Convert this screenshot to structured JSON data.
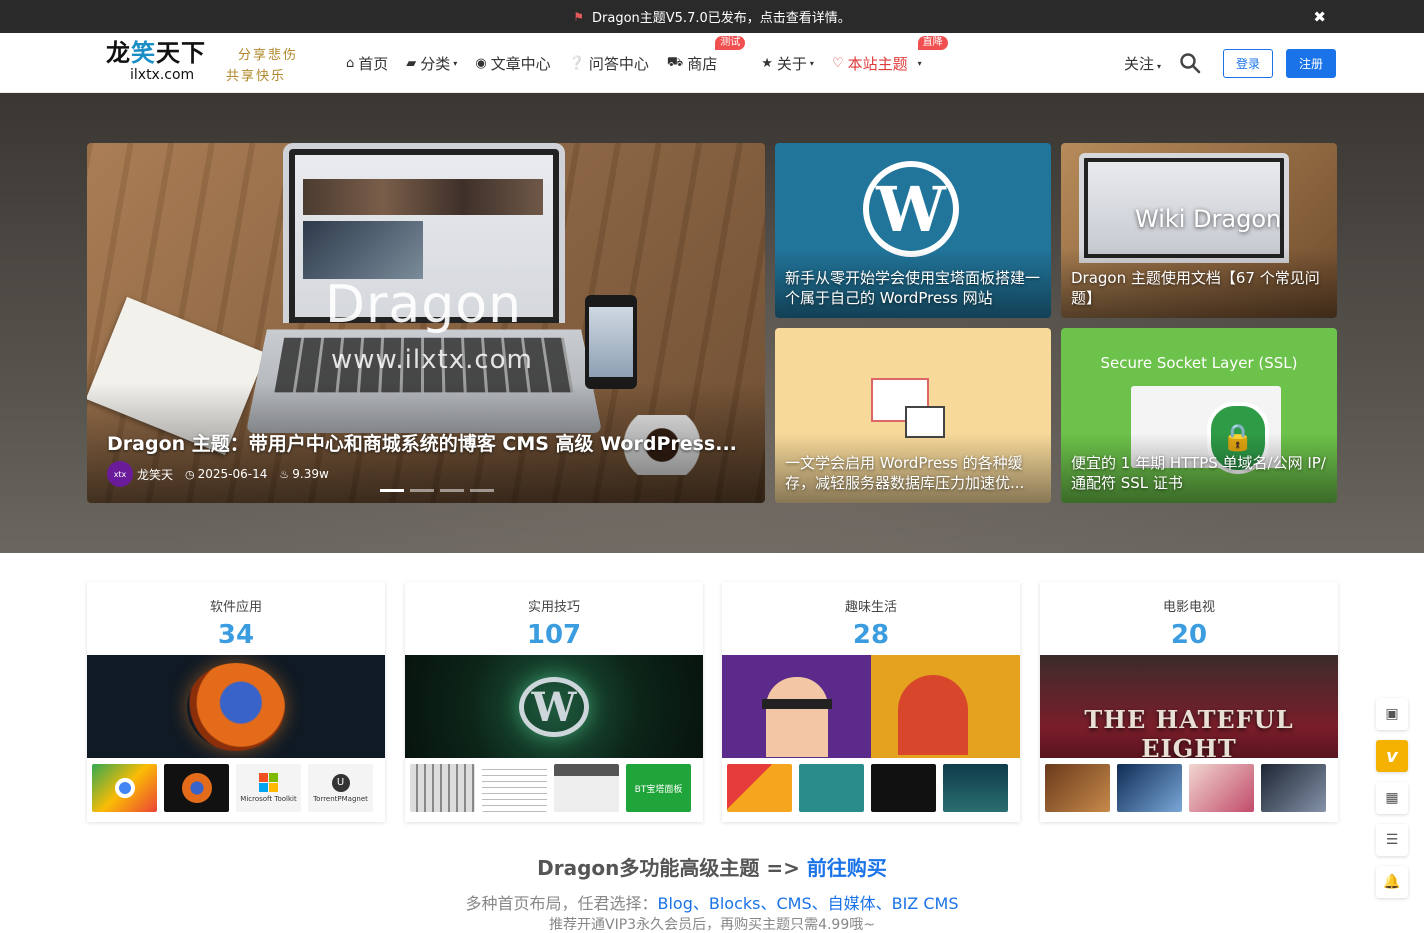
{
  "announce": {
    "text": "Dragon主题V5.7.0已发布，点击查看详情。",
    "close": "✖"
  },
  "logo": {
    "main_a": "龙",
    "main_hl": "笑",
    "main_b": "天下",
    "url": "ilxtx.com",
    "slogan_1": "分享悲伤",
    "slogan_2": "共享快乐"
  },
  "nav": {
    "items": [
      {
        "icon": "⌂",
        "label": "首页"
      },
      {
        "icon": "▰",
        "label": "分类",
        "caret": "▾"
      },
      {
        "icon": "◉",
        "label": "文章中心"
      },
      {
        "icon": "❔",
        "label": "问答中心"
      },
      {
        "icon": "⛟",
        "label": "商店",
        "badge": "测试"
      },
      {
        "icon": "★",
        "label": "关于",
        "caret": "▾"
      },
      {
        "icon": "♡",
        "label": "本站主题",
        "badge": "直降",
        "caret": "▾"
      }
    ]
  },
  "header_right": {
    "follow": "关注",
    "caret": "▾",
    "login": "登录",
    "register": "注册"
  },
  "hero": {
    "slide": {
      "word": "Dragon",
      "url": "www.ilxtx.com",
      "title": "Dragon 主题：带用户中心和商城系统的博客 CMS 高级 WordPress...",
      "avatar": "xtx",
      "author": "龙笑天",
      "date": "2025-06-14",
      "views": "9.39w"
    },
    "tiles": [
      {
        "title": "新手从零开始学会使用宝塔面板搭建一个属于自己的 WordPress 网站",
        "logo": "W"
      },
      {
        "title": "Dragon 主题使用文档【67 个常见问题】",
        "word": "Wiki Dragon"
      },
      {
        "title": "一文学会启用 WordPress 的各种缓存，减轻服务器数据库压力加速优..."
      },
      {
        "title": "便宜的 1 年期 HTTPS 单域名/公网 IP/通配符 SSL 证书",
        "word": "Secure Socket Layer (SSL)"
      }
    ]
  },
  "categories": [
    {
      "name": "软件应用",
      "count": "34",
      "thumbs": [
        "",
        "",
        "Microsoft Toolkit",
        "TorrentPMagnet"
      ]
    },
    {
      "name": "实用技巧",
      "count": "107",
      "thumbs": [
        "",
        "",
        "",
        "BT宝塔面板"
      ]
    },
    {
      "name": "趣味生活",
      "count": "28",
      "thumbs": [
        "",
        "",
        "",
        ""
      ]
    },
    {
      "name": "电影电视",
      "count": "20",
      "banner": "THE HATEFUL EIGHT",
      "thumbs": [
        "",
        "",
        "",
        ""
      ]
    }
  ],
  "promo": {
    "title": "Dragon多功能高级主题 => ",
    "title_link": "前往购买",
    "sub_prefix": "多种首页布局，任君选择：",
    "sub_link": "Blog、Blocks、CMS、自媒体、BIZ CMS",
    "sub2": "推荐开通VIP3永久会员后，再购买主题只需4.99哦~"
  },
  "float_bar": {
    "vip": "v"
  },
  "colors": {
    "accent": "#1a73e8",
    "count_blue": "#3b9de0",
    "red": "#e03a3a",
    "vip": "#f5b100"
  }
}
